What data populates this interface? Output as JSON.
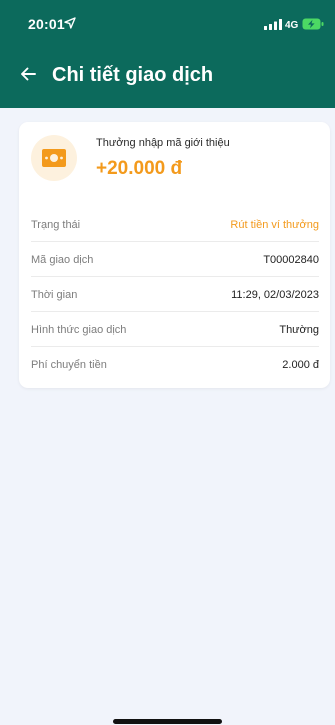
{
  "status_bar": {
    "time": "20:01",
    "network": "4G"
  },
  "header": {
    "title": "Chi tiết giao dịch"
  },
  "transaction": {
    "name": "Thưởng nhập mã giới thiệu",
    "amount": "+20.000 đ"
  },
  "details": [
    {
      "label": "Trạng thái",
      "value": "Rút tiền ví thưởng"
    },
    {
      "label": "Mã giao dịch",
      "value": "T00002840"
    },
    {
      "label": "Thời gian",
      "value": "11:29, 02/03/2023"
    },
    {
      "label": "Hình thức giao dịch",
      "value": "Thường"
    },
    {
      "label": "Phí chuyển tiền",
      "value": "2.000 đ"
    }
  ],
  "icons": {
    "back": "arrow-left-icon",
    "location": "location-arrow-icon",
    "signal": "signal-bars-icon",
    "battery": "battery-charging-icon",
    "transaction": "money-bill-icon"
  },
  "colors": {
    "header_bg": "#0c6a5c",
    "accent": "#f39a1c",
    "page_bg": "#f1f4fb",
    "battery": "#4cd964"
  }
}
